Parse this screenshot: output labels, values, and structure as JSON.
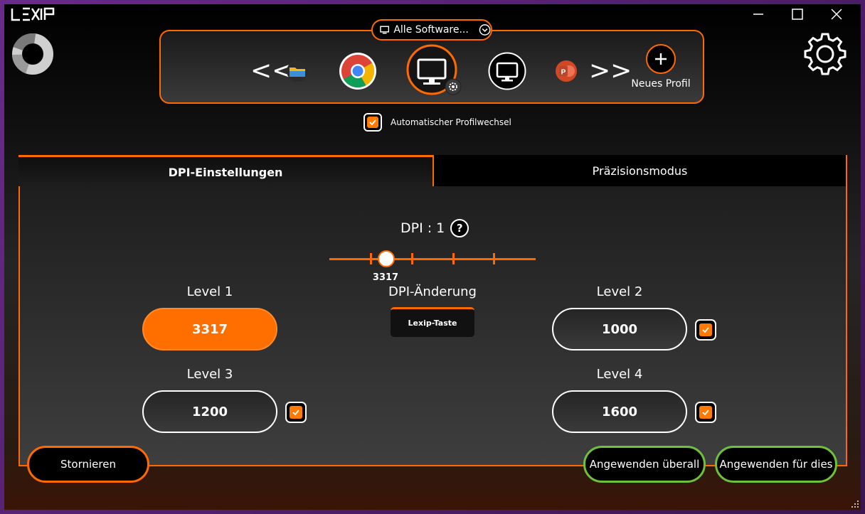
{
  "window": {
    "logo_text": "LEXIP",
    "controls": [
      "minimize",
      "maximize",
      "close"
    ]
  },
  "profile_bar": {
    "software_filter": "Alle Software...",
    "apps": [
      {
        "icon": "folder-icon"
      },
      {
        "icon": "chrome-icon"
      },
      {
        "icon": "desktop-icon",
        "active": true
      },
      {
        "icon": "desktop-icon"
      },
      {
        "icon": "powerpoint-icon"
      }
    ],
    "prev_label": "<<",
    "next_label": ">>",
    "new_profile_label": "Neues Profil"
  },
  "auto_switch": {
    "label": "Automatischer Profilwechsel",
    "checked": true
  },
  "tabs": [
    {
      "label": "DPI-Einstellungen",
      "active": true
    },
    {
      "label": "Präzisionsmodus",
      "active": false
    }
  ],
  "dpi": {
    "title": "DPI : 1",
    "help": "?",
    "slider_value": "3317",
    "change_label": "DPI-Änderung",
    "change_button": "Lexip-Taste",
    "levels": [
      {
        "label": "Level 1",
        "value": "3317",
        "active": true,
        "checked": null
      },
      {
        "label": "Level 2",
        "value": "1000",
        "active": false,
        "checked": true
      },
      {
        "label": "Level 3",
        "value": "1200",
        "active": false,
        "checked": true
      },
      {
        "label": "Level 4",
        "value": "1600",
        "active": false,
        "checked": true
      }
    ]
  },
  "buttons": {
    "cancel": "Stornieren",
    "apply_all": "Angewenden überall",
    "apply_this": "Angewenden für dies"
  },
  "colors": {
    "accent": "#ff6a00",
    "confirm": "#6fc13a"
  }
}
